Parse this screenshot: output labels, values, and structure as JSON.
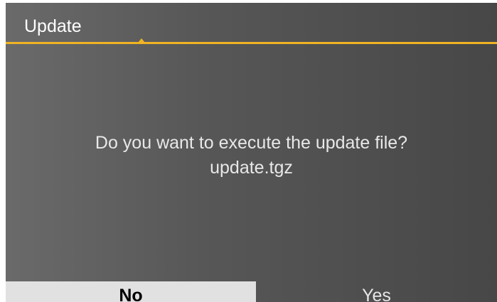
{
  "dialog": {
    "title": "Update",
    "message_line1": "Do you want to execute the update file?",
    "message_line2": "update.tgz"
  },
  "buttons": {
    "no_label": "No",
    "yes_label": "Yes"
  },
  "colors": {
    "accent": "#f0b323",
    "background": "#575757",
    "selected_button_bg": "#e1e1e1"
  }
}
